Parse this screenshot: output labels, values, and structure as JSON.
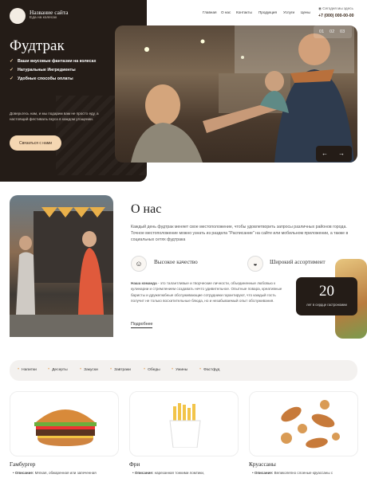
{
  "header": {
    "site_title": "Название сайта",
    "site_subtitle": "Еда на колесах",
    "nav": [
      "Главная",
      "О нас",
      "Контакты",
      "Продукция",
      "Услуги",
      "Цены"
    ],
    "phone_note": "Сегодня мы здесь",
    "phone": "+7 (000) 000-00-00"
  },
  "hero": {
    "title": "Фудтрак",
    "features": [
      "Ваши вкусовые фантазии на колесах",
      "Натуральные Ингредиенты",
      "Удобные способы оплаты"
    ],
    "text": "Доверьтесь нам, и мы подарим вам не просто еду, а настоящий фестиваль вкуса в каждом угощении.",
    "button": "Связаться с нами",
    "slides": [
      "01",
      "02",
      "03"
    ]
  },
  "about": {
    "title": "О нас",
    "text": "Каждый день фудтрак меняет свое местоположение, чтобы удовлетворить запросы различных районов города. Точное местоположение можно узнать из раздела \"Расписание\" на сайте или мобильном приложении, а также в социальных сетях фудтрака",
    "feature1": "Высокое качество",
    "feature2": "Широкий ассортимент",
    "team_label": "Наша команда",
    "team_text": " - это талантливые и творческие личности, объединенные любовью к кулинарии и стремлением создавать нечто удивительное. Опытные повара, креативные баристы и дружелюбные обслуживающие сотрудники гарантируют, что каждый гость получит не только восхитительные блюда, но и незабываемый опыт обслуживания.",
    "more": "Подробнее",
    "stat_number": "20",
    "stat_label": "лет в сердце гастрономии"
  },
  "categories": [
    "Напитки",
    "Десерты",
    "Закуски",
    "Завтраки",
    "Обеды",
    "Ужины",
    "Фастфуд"
  ],
  "cards": [
    {
      "name": "Гамбургер",
      "label": "Описание:",
      "desc": "Мягкая, обжаренная или запеченная"
    },
    {
      "name": "Фри",
      "label": "Описание:",
      "desc": "нарезанная тонкими ломтики,"
    },
    {
      "name": "Круассаны",
      "label": "Описание:",
      "desc": "Великолепно слоеные круассаны с"
    }
  ],
  "colors": {
    "dark": "#241c17",
    "accent": "#f5d7b2"
  }
}
